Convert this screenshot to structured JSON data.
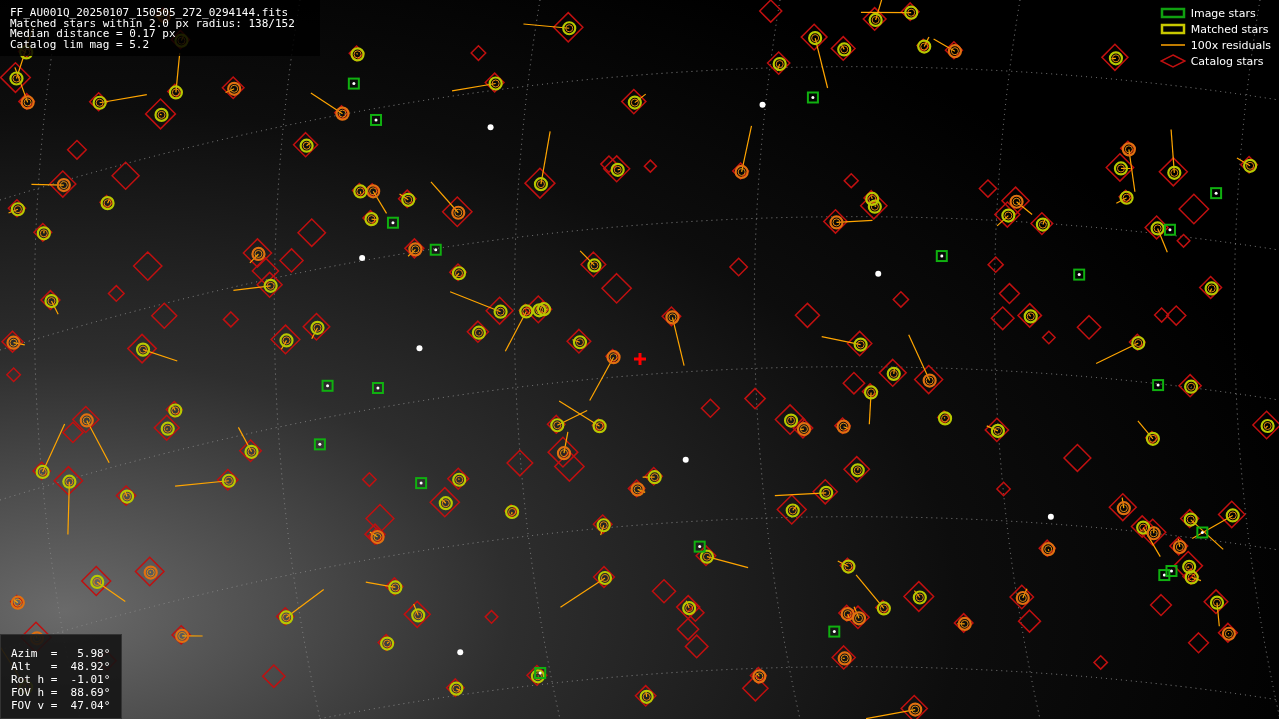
{
  "info_panel": {
    "lines": [
      "FF_AU001Q_20250107_150505_272_0294144.fits",
      "Matched stars within 2.0 px radius: 138/152",
      "Median distance = 0.17 px",
      "Catalog lim mag = 5.2"
    ]
  },
  "legend": [
    {
      "kind": "image",
      "label": "Image stars"
    },
    {
      "kind": "matched",
      "label": "Matched stars"
    },
    {
      "kind": "residual",
      "label": "100x residuals"
    },
    {
      "kind": "catalog",
      "label": "Catalog stars"
    }
  ],
  "pointing_panel": {
    "lines": [
      "Azim  =   5.98°",
      "Alt   =  48.92°",
      "Rot h =  -1.01°",
      "FOV h =  88.69°",
      "FOV v =  47.04°"
    ]
  }
}
